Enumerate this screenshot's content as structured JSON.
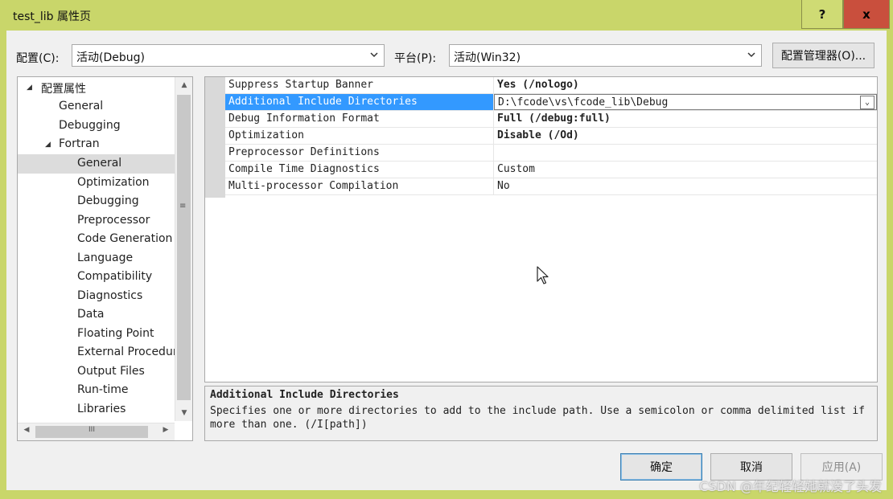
{
  "window": {
    "title": "test_lib 属性页",
    "help_label": "?",
    "close_label": "x"
  },
  "toolbar": {
    "config_label": "配置(C):",
    "config_value": "活动(Debug)",
    "platform_label": "平台(P):",
    "platform_value": "活动(Win32)",
    "config_manager_label": "配置管理器(O)..."
  },
  "tree": {
    "items": [
      {
        "label": "配置属性",
        "expander": "◢"
      },
      {
        "label": "General"
      },
      {
        "label": "Debugging"
      },
      {
        "label": "Fortran",
        "expander": "◢"
      },
      {
        "label": "General"
      },
      {
        "label": "Optimization"
      },
      {
        "label": "Debugging"
      },
      {
        "label": "Preprocessor"
      },
      {
        "label": "Code Generation"
      },
      {
        "label": "Language"
      },
      {
        "label": "Compatibility"
      },
      {
        "label": "Diagnostics"
      },
      {
        "label": "Data"
      },
      {
        "label": "Floating Point"
      },
      {
        "label": "External Procedur"
      },
      {
        "label": "Output Files"
      },
      {
        "label": "Run-time"
      },
      {
        "label": "Libraries"
      }
    ],
    "selected_index": 4,
    "scroll_up": "▲",
    "scroll_down": "▼",
    "scroll_grip": "≡",
    "scroll_left": "◀",
    "scroll_right": "▶",
    "hgrip": "III"
  },
  "properties": {
    "rows": [
      {
        "name": "Suppress Startup Banner",
        "value": "Yes (/nologo)",
        "bold": true
      },
      {
        "name": "Additional Include Directories",
        "value": "D:\\fcode\\vs\\fcode_lib\\Debug",
        "bold": false,
        "selected": true
      },
      {
        "name": "Debug Information Format",
        "value": "Full (/debug:full)",
        "bold": true
      },
      {
        "name": "Optimization",
        "value": "Disable (/Od)",
        "bold": true
      },
      {
        "name": "Preprocessor Definitions",
        "value": "",
        "bold": false
      },
      {
        "name": "Compile Time Diagnostics",
        "value": "Custom",
        "bold": false
      },
      {
        "name": "Multi-processor Compilation",
        "value": "No",
        "bold": false
      }
    ],
    "dropdown_glyph": "⌄"
  },
  "description": {
    "title": "Additional Include Directories",
    "body": "Specifies one or more directories to add to the include path. Use a semicolon or comma delimited list if more than one. (/I[path])"
  },
  "buttons": {
    "ok": "确定",
    "cancel": "取消",
    "apply": "应用(A)"
  },
  "watermark": "CSDN @年纪轻轻她就没了头发",
  "colors": {
    "title_bar": "#c9d66a",
    "selection": "#3399ff",
    "close_button": "#c94f3d"
  }
}
